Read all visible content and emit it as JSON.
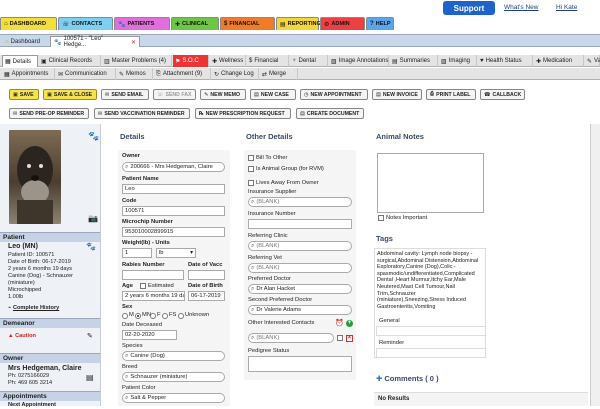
{
  "nav": {
    "tabs": [
      {
        "label": "DASHBOARD",
        "icon": "home-icon",
        "color": "#f4df3a"
      },
      {
        "label": "CONTACTS",
        "icon": "contacts-icon",
        "color": "#7fd0f0"
      },
      {
        "label": "PATIENTS",
        "icon": "paw-icon",
        "color": "#e06edb"
      },
      {
        "label": "CLINICAL",
        "icon": "clinical-icon",
        "color": "#6fc646"
      },
      {
        "label": "FINANCIAL",
        "icon": "financial-icon",
        "color": "#f07c2a"
      },
      {
        "label": "REPORTING",
        "icon": "reporting-icon",
        "color": "#f6d636"
      },
      {
        "label": "ADMIN",
        "icon": "admin-icon",
        "color": "#ee4040"
      },
      {
        "label": "HELP",
        "icon": "help-icon",
        "color": "#5aa5ee"
      }
    ],
    "support_label": "Support",
    "whats_new": "What's New",
    "user": "Hi Kate"
  },
  "subtabs": {
    "dashboard": "Dashboard",
    "patient": "100571 - \"Leo\" Hedge..."
  },
  "row1": [
    {
      "label": "Details",
      "icon": "details-icon",
      "active": true
    },
    {
      "label": "Clinical Records",
      "icon": "records-icon"
    },
    {
      "label": "Master Problems (4)",
      "icon": "problems-icon"
    },
    {
      "label": "S.O.C",
      "icon": "soc-icon",
      "soc": true
    },
    {
      "label": "Wellness",
      "icon": "plus-icon"
    },
    {
      "label": "Financial",
      "icon": "financial-icon"
    },
    {
      "label": "Dental",
      "icon": "tooth-icon"
    },
    {
      "label": "Image Annotations",
      "icon": "image-icon"
    },
    {
      "label": "Summaries",
      "icon": "summaries-icon"
    },
    {
      "label": "Imaging",
      "icon": "imaging-icon"
    },
    {
      "label": "Health Status",
      "icon": "heart-icon"
    },
    {
      "label": "Medication",
      "icon": "medication-icon"
    },
    {
      "label": "Vacc",
      "icon": "vacc-icon"
    }
  ],
  "row2": [
    {
      "label": "Appointments",
      "icon": "calendar-icon"
    },
    {
      "label": "Communication",
      "icon": "mail-icon"
    },
    {
      "label": "Memos",
      "icon": "memo-icon"
    },
    {
      "label": "Attachment (9)",
      "icon": "attachment-icon"
    },
    {
      "label": "Change Log",
      "icon": "log-icon"
    },
    {
      "label": "Merge",
      "icon": "merge-icon"
    }
  ],
  "toolbar": {
    "row1": [
      {
        "label": "SAVE",
        "style": "yellow",
        "icon": "save-icon"
      },
      {
        "label": "SAVE & CLOSE",
        "style": "yellow",
        "icon": "save-close-icon"
      },
      {
        "label": "SEND EMAIL",
        "icon": "email-icon"
      },
      {
        "label": "SEND FAX",
        "icon": "fax-icon",
        "disabled": true
      },
      {
        "label": "NEW MEMO",
        "icon": "memo-icon"
      },
      {
        "label": "NEW CASE",
        "icon": "case-icon"
      },
      {
        "label": "NEW APPOINTMENT",
        "icon": "appointment-icon"
      },
      {
        "label": "NEW INVOICE",
        "icon": "invoice-icon"
      },
      {
        "label": "PRINT LABEL",
        "icon": "print-icon"
      },
      {
        "label": "CALLBACK",
        "icon": "callback-icon"
      }
    ],
    "row2": [
      {
        "label": "SEND PRE-OP REMINDER",
        "icon": "reminder-icon"
      },
      {
        "label": "SEND VACCINATION REMINDER",
        "icon": "reminder-icon"
      },
      {
        "label": "NEW PRESCRIPTION REQUEST",
        "icon": "prescription-icon"
      },
      {
        "label": "CREATE DOCUMENT",
        "icon": "document-icon"
      }
    ]
  },
  "sidebar": {
    "patient_header": "Patient",
    "name": "Leo (MN)",
    "lines": [
      "Patient ID: 100571",
      "Date of Birth: 06-17-2019",
      "2 years 6 months 19 days",
      "Canine (Dog) - Schnauzer",
      "(miniature)",
      "Microchipped",
      "1.00lb"
    ],
    "complete_history": "Complete History",
    "demeanor_header": "Demeanor",
    "caution": "Caution",
    "owner_header": "Owner",
    "owner_name": "Mrs Hedgeman, Claire",
    "owner_phone1": "Ph: 0275166029",
    "owner_phone2": "Ph: 469 605 3214",
    "appointments_header": "Appointments",
    "next_appointment": "Next Appointment"
  },
  "details": {
    "title": "Details",
    "owner_label": "Owner",
    "owner_value": "200666 - Mrs Hedgeman, Claire",
    "patient_name_label": "Patient Name",
    "patient_name": "Leo",
    "code_label": "Code",
    "code": "100571",
    "microchip_label": "Microchip Number",
    "microchip": "953010002899915",
    "weight_label": "Weight(lb) - Units",
    "weight_value": "1",
    "weight_unit": "lb",
    "rabies_label": "Rabies Number",
    "date_vacc_label": "Date of Vacc",
    "age_label": "Age",
    "estimated_label": "Estimated",
    "dob_label": "Date of Birth",
    "age_value": "2 years 6 months 19 day",
    "dob_value": "06-17-2019",
    "sex_label": "Sex",
    "sex_options": [
      "M",
      "MN",
      "F",
      "FS",
      "Unknown"
    ],
    "date_deceased_label": "Date Deceased",
    "date_deceased": "02-20-2020",
    "species_label": "Species",
    "species": "Canine (Dog)",
    "breed_label": "Breed",
    "breed": "Schnauzer (miniature)",
    "color_label": "Patient Color",
    "color": "Salt & Pepper"
  },
  "other": {
    "title": "Other Details",
    "bill_to_other": "Bill To Other",
    "is_animal_group": "Is Animal Group (for RVM)",
    "lives_away": "Lives Away From Owner",
    "insurance_supplier_label": "Insurance Supplier",
    "blank": "(BLANK)",
    "insurance_number_label": "Insurance Number",
    "referring_clinic_label": "Referring Clinic",
    "referring_vet_label": "Referring Vet",
    "preferred_doctor_label": "Preferred Doctor",
    "preferred_doctor": "Dr Alan Hacket",
    "second_preferred_label": "Second Preferred Doctor",
    "second_preferred": "Dr Valerie Adams",
    "interested_contacts_label": "Other Interested Contacts",
    "pedigree_label": "Pedigree Status"
  },
  "notes": {
    "title": "Animal Notes",
    "notes_important": "Notes Important",
    "tags_title": "Tags",
    "tags_text": "Abdominal cavity: Lymph node biopsy - surgical,Abdominal Distension,Abdominal Exploratory,Canine (Dog),Colic - spasmodic/undifferentiated,Complicated Dental ,Heart Murmur,Itchy Ear,Male Neutered,Mast Cell Tumour,Nail Trim,Schnauzer (miniature),Sneezing,Stress Induced Gastroenteritis,Vomiting",
    "general_label": "General",
    "reminder_label": "Reminder",
    "comments": "Comments ( 0 )",
    "no_results": "No Results"
  }
}
